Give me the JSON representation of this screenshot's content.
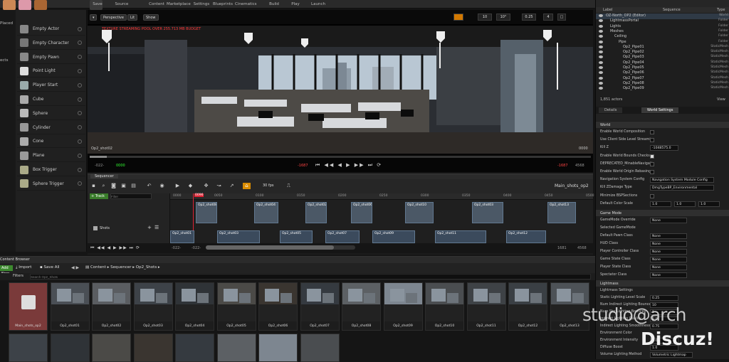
{
  "toolbar": {
    "items": [
      "Save Current",
      "Source Control",
      "Content",
      "Marketplace",
      "Settings",
      "Blueprints",
      "Cinematics",
      "Build",
      "Play",
      "Launch"
    ]
  },
  "left_panel": {
    "categories": [
      "Placed",
      "ects"
    ],
    "actors": [
      {
        "label": "Empty Actor",
        "icon": "empty-actor-icon"
      },
      {
        "label": "Empty Character",
        "icon": "character-icon"
      },
      {
        "label": "Empty Pawn",
        "icon": "pawn-icon"
      },
      {
        "label": "Point Light",
        "icon": "point-light-icon"
      },
      {
        "label": "Player Start",
        "icon": "player-start-icon"
      },
      {
        "label": "Cube",
        "icon": "cube-icon"
      },
      {
        "label": "Sphere",
        "icon": "sphere-icon"
      },
      {
        "label": "Cylinder",
        "icon": "cylinder-icon"
      },
      {
        "label": "Cone",
        "icon": "cone-icon"
      },
      {
        "label": "Plane",
        "icon": "plane-icon"
      },
      {
        "label": "Box Trigger",
        "icon": "box-trigger-icon"
      },
      {
        "label": "Sphere Trigger",
        "icon": "sphere-trigger-icon"
      }
    ]
  },
  "viewport": {
    "perspective": "Perspective",
    "lit": "Lit",
    "show": "Show",
    "warning": "TEXTURE STREAMING POOL OVER 255.713 MB BUDGET",
    "right_controls": [
      "10",
      "10°",
      "0.25",
      "4"
    ],
    "shot_name": "Op2_shot02",
    "timecode_left": "-022-",
    "timecode_mid": "0000",
    "timecode_right": "0000",
    "end_left": "-1687",
    "end_right": "4568"
  },
  "sequencer": {
    "tab": "Sequencer",
    "fps": "30 fps",
    "sequence_name": "Main_shots_op2",
    "track_button": "+ Track",
    "filter_placeholder": "Filter",
    "shots_label": "Shots",
    "playhead": "0096",
    "ruler": [
      "0000",
      "0050",
      "0100",
      "0150",
      "0200",
      "0250",
      "0300",
      "0350",
      "0400",
      "0450",
      "0500"
    ],
    "footer": {
      "left1": "-022-",
      "left2": "-022-",
      "right1": "1681",
      "right2": "4568"
    },
    "clips_top": [
      "Op2_shot08",
      "Op2_shot04",
      "Op2_shot02",
      "Op2_shot06",
      "Op2_shot10",
      "Op2_shot03",
      "Op2_shot13"
    ],
    "clips_bottom": [
      "Op2_shot01",
      "Op2_shot03",
      "Op2_shot05",
      "Op2_shot07",
      "Op2_shot09",
      "Op2_shot11",
      "Op2_shot12"
    ]
  },
  "outliner": {
    "headers": [
      "Label",
      "Sequence",
      "Type"
    ],
    "rows": [
      {
        "label": "OZ-North_OP2 (Editor)",
        "type": "World",
        "indent": 0
      },
      {
        "label": "LightmassPortal",
        "type": "Folder",
        "indent": 1
      },
      {
        "label": "Lights",
        "type": "Folder",
        "indent": 1
      },
      {
        "label": "Meshes",
        "type": "Folder",
        "indent": 1
      },
      {
        "label": "Ceiling",
        "type": "Folder",
        "indent": 2
      },
      {
        "label": "Pipe",
        "type": "Folder",
        "indent": 3
      },
      {
        "label": "Op2_Pipe01",
        "type": "StaticMesh",
        "indent": 4
      },
      {
        "label": "Op2_Pipe02",
        "type": "StaticMesh",
        "indent": 4
      },
      {
        "label": "Op2_Pipe03",
        "type": "StaticMesh",
        "indent": 4
      },
      {
        "label": "Op2_Pipe04",
        "type": "StaticMesh",
        "indent": 4
      },
      {
        "label": "Op2_Pipe05",
        "type": "StaticMesh",
        "indent": 4
      },
      {
        "label": "Op2_Pipe06",
        "type": "StaticMesh",
        "indent": 4
      },
      {
        "label": "Op2_Pipe07",
        "type": "StaticMesh",
        "indent": 4
      },
      {
        "label": "Op2_Pipe08",
        "type": "StaticMesh",
        "indent": 4
      },
      {
        "label": "Op2_Pipe09",
        "type": "StaticMesh",
        "indent": 4
      }
    ],
    "count": "1,851 actors",
    "view": "View"
  },
  "details": {
    "tabs": [
      "Details",
      "World Settings"
    ],
    "world": {
      "title": "World",
      "rows": [
        {
          "label": "Enable World Composition",
          "type": "check",
          "on": false
        },
        {
          "label": "Use Client Side Level Streami",
          "type": "check",
          "on": false
        },
        {
          "label": "Kill Z",
          "type": "field",
          "value": "-1048575.0"
        },
        {
          "label": "Enable World Bounds Checks",
          "type": "check",
          "on": true
        },
        {
          "label": "DEPRECATED_MinableNavigati",
          "type": "check",
          "on": false
        },
        {
          "label": "Enable World Origin Rebasing",
          "type": "check",
          "on": false
        },
        {
          "label": "Navigation System Config",
          "type": "field",
          "value": "Navigation System Module Config"
        },
        {
          "label": "Kill ZDamage Type",
          "type": "field",
          "value": "DmgTypeBP_Environmental"
        },
        {
          "label": "Minimize BSPSections",
          "type": "check",
          "on": false
        },
        {
          "label": "Default Color Scale",
          "type": "xyz",
          "x": "1.0",
          "y": "1.0",
          "z": "1.0"
        }
      ]
    },
    "gamemode": {
      "title": "Game Mode",
      "rows": [
        {
          "label": "GameMode Override",
          "value": "None"
        },
        {
          "label": "Selected GameMode",
          "value": ""
        },
        {
          "label": "Default Pawn Class",
          "value": "None"
        },
        {
          "label": "HUD Class",
          "value": "None"
        },
        {
          "label": "Player Controller Class",
          "value": "None"
        },
        {
          "label": "Game State Class",
          "value": "None"
        },
        {
          "label": "Player State Class",
          "value": "None"
        },
        {
          "label": "Spectator Class",
          "value": "None"
        }
      ]
    },
    "lightmass": {
      "title": "Lightmass",
      "rows": [
        {
          "label": "Lightmass Settings",
          "value": ""
        },
        {
          "label": "Static Lighting Level Scale",
          "value": "0.25"
        },
        {
          "label": "Num Indirect Lighting Bounce",
          "value": "10"
        },
        {
          "label": "Num Sky Lighting Bounces",
          "value": "1"
        },
        {
          "label": "Indirect Lighting Quality",
          "value": "8.0"
        },
        {
          "label": "Indirect Lighting Smoothness",
          "value": "0.75"
        },
        {
          "label": "Environment Color",
          "value": ""
        },
        {
          "label": "Environment Intensity",
          "value": "1.0"
        },
        {
          "label": "Diffuse Boost",
          "value": "1.0"
        },
        {
          "label": "Volume Lighting Method",
          "value": "Volumetric Lightmap"
        }
      ]
    }
  },
  "content_browser": {
    "tab": "Content Browser",
    "add_new": "Add New",
    "import": "Import",
    "save_all": "Save All",
    "path": [
      "Content",
      "Sequencer",
      "Op2_Shots"
    ],
    "filters": "Filters",
    "search_placeholder": "Search Op2_Shots",
    "assets": [
      "Main_shots_op2",
      "Op2_shot01",
      "Op2_shot02",
      "Op2_shot03",
      "Op2_shot04",
      "Op2_shot05",
      "Op2_shot06",
      "Op2_shot07",
      "Op2_shot08",
      "Op2_shot09",
      "Op2_shot10",
      "Op2_shot11",
      "Op2_shot12",
      "Op2_shot13"
    ]
  },
  "watermark": {
    "line1": "studio@arch",
    "line2": "Discuz!"
  }
}
